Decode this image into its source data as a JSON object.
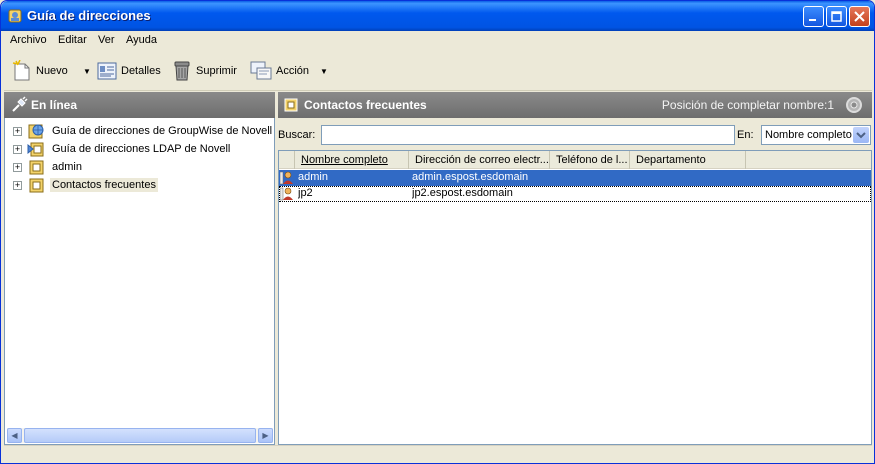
{
  "window": {
    "title": "Guía de direcciones"
  },
  "menu": {
    "items": [
      "Archivo",
      "Editar",
      "Ver",
      "Ayuda"
    ]
  },
  "toolbar": {
    "new_label": "Nuevo",
    "details_label": "Detalles",
    "delete_label": "Suprimir",
    "action_label": "Acción"
  },
  "left_pane": {
    "title": "En línea",
    "tree": [
      {
        "label": "Guía de direcciones de GroupWise de Novell",
        "icon": "groupwise-book-icon"
      },
      {
        "label": "Guía de direcciones LDAP de Novell",
        "icon": "ldap-book-icon"
      },
      {
        "label": "admin",
        "icon": "address-book-icon"
      },
      {
        "label": "Contactos frecuentes",
        "icon": "address-book-icon",
        "selected": true
      }
    ]
  },
  "right_pane": {
    "title": "Contactos frecuentes",
    "completion_position": "Posición de completar nombre:1",
    "search_label": "Buscar:",
    "search_value": "",
    "in_label": "En:",
    "in_value": "Nombre completo",
    "columns": [
      "Nombre completo",
      "Dirección de correo electr...",
      "Teléfono de l...",
      "Departamento"
    ],
    "rows": [
      {
        "name": "admin",
        "email": "admin.espost.esdomain",
        "phone": "",
        "department": "",
        "selected": true
      },
      {
        "name": "jp2",
        "email": "jp2.espost.esdomain",
        "phone": "",
        "department": "",
        "focused": true
      }
    ]
  },
  "colors": {
    "titlebar": "#0054e3",
    "selection": "#316ac5",
    "pane_header": "#7a7a7a"
  }
}
